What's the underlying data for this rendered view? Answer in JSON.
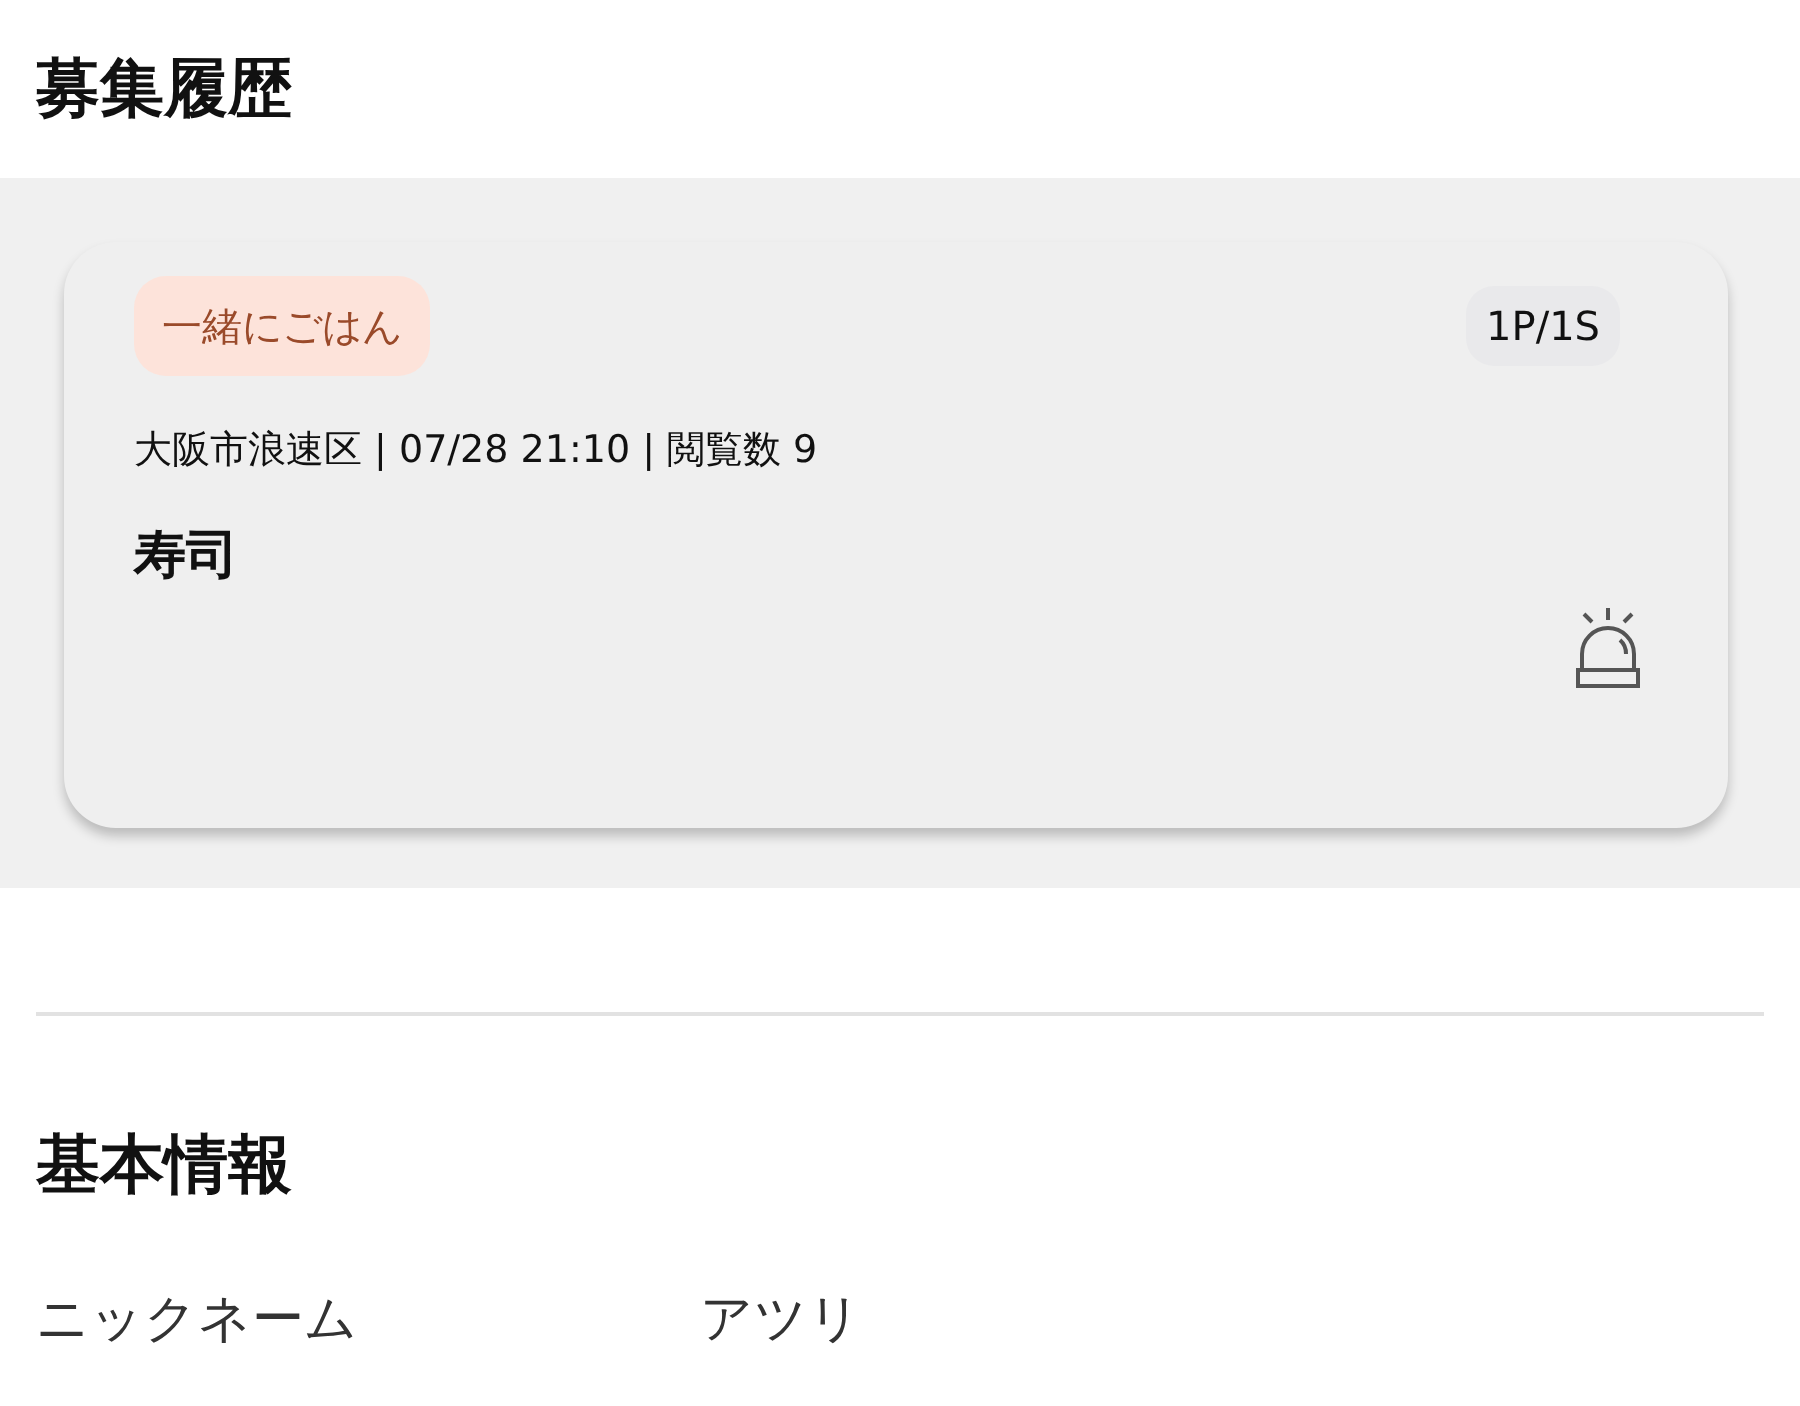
{
  "history_section": {
    "title": "募集履歴"
  },
  "posts": [
    {
      "tag": "一緒にごはん",
      "count": "1P/1S",
      "meta": "大阪市浪速区 | 07/28 21:10 | 閲覧数 9",
      "title": "寿司"
    }
  ],
  "basic_info": {
    "title": "基本情報",
    "fields": [
      {
        "label": "ニックネーム",
        "value": "アツリ"
      }
    ]
  }
}
